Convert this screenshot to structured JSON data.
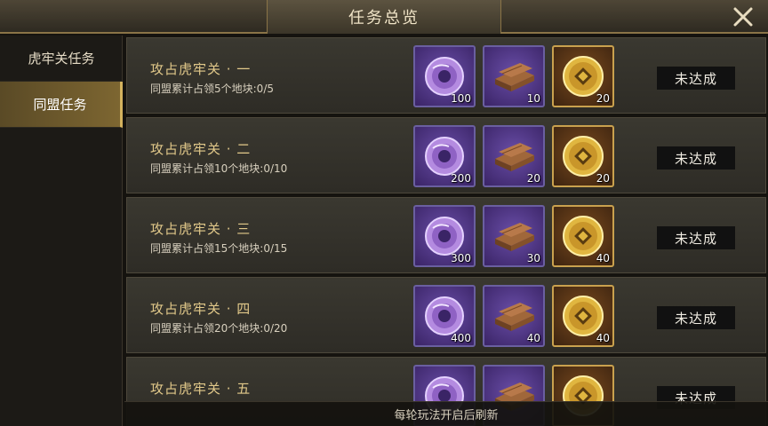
{
  "header": {
    "title": "任务总览"
  },
  "sidebar": {
    "tabs": [
      {
        "label": "虎牢关任务",
        "active": false
      },
      {
        "label": "同盟任务",
        "active": true
      }
    ]
  },
  "tasks": [
    {
      "title": "攻占虎牢关 · 一",
      "desc": "同盟累计占领5个地块:0/5",
      "rewards": [
        {
          "icon": "purple-jade-disc-icon",
          "qty": "100"
        },
        {
          "icon": "wood-planks-icon",
          "qty": "10"
        },
        {
          "icon": "gold-coin-icon",
          "qty": "20"
        }
      ],
      "status": "未达成"
    },
    {
      "title": "攻占虎牢关 · 二",
      "desc": "同盟累计占领10个地块:0/10",
      "rewards": [
        {
          "icon": "purple-jade-disc-icon",
          "qty": "200"
        },
        {
          "icon": "wood-planks-icon",
          "qty": "20"
        },
        {
          "icon": "gold-coin-icon",
          "qty": "20"
        }
      ],
      "status": "未达成"
    },
    {
      "title": "攻占虎牢关 · 三",
      "desc": "同盟累计占领15个地块:0/15",
      "rewards": [
        {
          "icon": "purple-jade-disc-icon",
          "qty": "300"
        },
        {
          "icon": "wood-planks-icon",
          "qty": "30"
        },
        {
          "icon": "gold-coin-icon",
          "qty": "40"
        }
      ],
      "status": "未达成"
    },
    {
      "title": "攻占虎牢关 · 四",
      "desc": "同盟累计占领20个地块:0/20",
      "rewards": [
        {
          "icon": "purple-jade-disc-icon",
          "qty": "400"
        },
        {
          "icon": "wood-planks-icon",
          "qty": "40"
        },
        {
          "icon": "gold-coin-icon",
          "qty": "40"
        }
      ],
      "status": "未达成"
    },
    {
      "title": "攻占虎牢关 · 五",
      "desc": "",
      "rewards": [
        {
          "icon": "purple-jade-disc-icon",
          "qty": ""
        },
        {
          "icon": "wood-planks-icon",
          "qty": ""
        },
        {
          "icon": "gold-coin-icon",
          "qty": ""
        }
      ],
      "status": "未达成"
    }
  ],
  "footer": {
    "note": "每轮玩法开启后刷新"
  },
  "colors": {
    "accent": "#d4b25e",
    "title_gold": "#e2c98a",
    "item_purple": "#6a4ea8"
  }
}
